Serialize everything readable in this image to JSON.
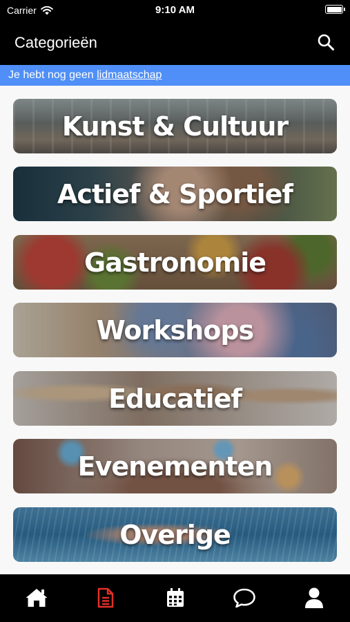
{
  "status": {
    "carrier": "Carrier",
    "time": "9:10 AM"
  },
  "header": {
    "title": "Categorieën"
  },
  "banner": {
    "text": "Je hebt nog geen ",
    "link": "lidmaatschap"
  },
  "categories": [
    {
      "label": "Kunst & Cultuur"
    },
    {
      "label": "Actief & Sportief"
    },
    {
      "label": "Gastronomie"
    },
    {
      "label": "Workshops"
    },
    {
      "label": "Educatief"
    },
    {
      "label": "Evenementen"
    },
    {
      "label": "Overige"
    }
  ],
  "tabs": [
    {
      "icon": "home-icon",
      "active": false
    },
    {
      "icon": "document-icon",
      "active": true
    },
    {
      "icon": "calendar-icon",
      "active": false
    },
    {
      "icon": "chat-icon",
      "active": false
    },
    {
      "icon": "user-icon",
      "active": false
    }
  ],
  "colors": {
    "banner": "#4f8ff7",
    "active_tab": "#e0312a",
    "tab": "#ffffff"
  }
}
